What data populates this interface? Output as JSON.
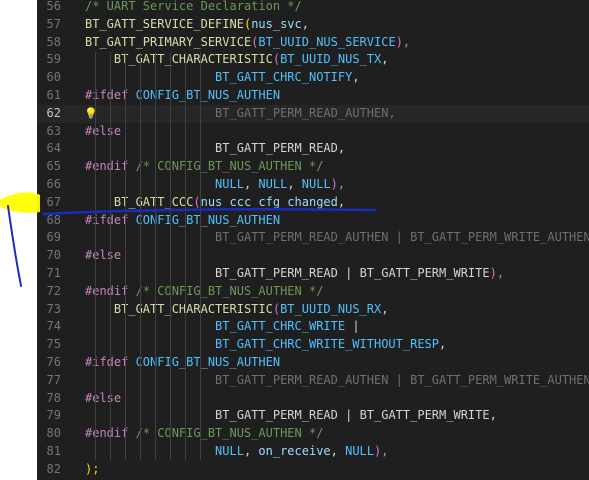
{
  "editor": {
    "current_line": 62,
    "lines": [
      {
        "num": "56",
        "tokens": [
          {
            "t": "/* UART Service Declaration */",
            "c": "t-comment"
          }
        ]
      },
      {
        "num": "57",
        "tokens": [
          {
            "t": "BT_GATT_SERVICE_DEFINE",
            "c": "t-macro"
          },
          {
            "t": "(",
            "c": "t-paren1"
          },
          {
            "t": "nus_svc",
            "c": "t-ident"
          },
          {
            "t": ",",
            "c": "t-plain"
          }
        ]
      },
      {
        "num": "58",
        "tokens": [
          {
            "t": "BT_GATT_PRIMARY_SERVICE",
            "c": "t-macro"
          },
          {
            "t": "(",
            "c": "t-paren2"
          },
          {
            "t": "BT_UUID_NUS_SERVICE",
            "c": "t-const"
          },
          {
            "t": "),",
            "c": "t-paren2"
          }
        ]
      },
      {
        "num": "59",
        "tokens": [
          {
            "t": "    BT_GATT_CHARACTERISTIC",
            "c": "t-macro"
          },
          {
            "t": "(",
            "c": "t-paren2"
          },
          {
            "t": "BT_UUID_NUS_TX",
            "c": "t-const"
          },
          {
            "t": ",",
            "c": "t-plain"
          }
        ]
      },
      {
        "num": "60",
        "tokens": [
          {
            "t": "                  BT_GATT_CHRC_NOTIFY",
            "c": "t-const"
          },
          {
            "t": ",",
            "c": "t-plain"
          }
        ]
      },
      {
        "num": "61",
        "tokens": [
          {
            "t": "#ifdef",
            "c": "t-pre"
          },
          {
            "t": " CONFIG_BT_NUS_AUTHEN",
            "c": "t-const"
          }
        ]
      },
      {
        "num": "62",
        "tokens": [
          {
            "t": "                  BT_GATT_PERM_READ_AUTHEN",
            "c": "t-dim"
          },
          {
            "t": ",",
            "c": "t-dim"
          }
        ]
      },
      {
        "num": "63",
        "tokens": [
          {
            "t": "#else",
            "c": "t-pre"
          }
        ]
      },
      {
        "num": "64",
        "tokens": [
          {
            "t": "                  BT_GATT_PERM_READ",
            "c": "t-plain"
          },
          {
            "t": ",",
            "c": "t-plain"
          }
        ]
      },
      {
        "num": "65",
        "tokens": [
          {
            "t": "#endif",
            "c": "t-pre"
          },
          {
            "t": " /* CONFIG_BT_NUS_AUTHEN */",
            "c": "t-comment"
          }
        ]
      },
      {
        "num": "66",
        "tokens": [
          {
            "t": "                  NULL",
            "c": "t-const"
          },
          {
            "t": ", ",
            "c": "t-plain"
          },
          {
            "t": "NULL",
            "c": "t-const"
          },
          {
            "t": ", ",
            "c": "t-plain"
          },
          {
            "t": "NULL",
            "c": "t-const"
          },
          {
            "t": "),",
            "c": "t-paren2"
          }
        ]
      },
      {
        "num": "67",
        "tokens": [
          {
            "t": "    BT_GATT_CCC",
            "c": "t-macro"
          },
          {
            "t": "(",
            "c": "t-paren2"
          },
          {
            "t": "nus_ccc_cfg_changed",
            "c": "t-ident"
          },
          {
            "t": ",",
            "c": "t-plain"
          }
        ]
      },
      {
        "num": "68",
        "tokens": [
          {
            "t": "#ifdef",
            "c": "t-pre"
          },
          {
            "t": " CONFIG_BT_NUS_AUTHEN",
            "c": "t-const"
          }
        ]
      },
      {
        "num": "69",
        "tokens": [
          {
            "t": "                  BT_GATT_PERM_READ_AUTHEN | BT_GATT_PERM_WRITE_AUTHEN",
            "c": "t-dim"
          }
        ]
      },
      {
        "num": "70",
        "tokens": [
          {
            "t": "#else",
            "c": "t-pre"
          }
        ]
      },
      {
        "num": "71",
        "tokens": [
          {
            "t": "                  BT_GATT_PERM_READ",
            "c": "t-plain"
          },
          {
            "t": " | ",
            "c": "t-plain"
          },
          {
            "t": "BT_GATT_PERM_WRITE",
            "c": "t-plain"
          },
          {
            "t": "),",
            "c": "t-paren2"
          }
        ]
      },
      {
        "num": "72",
        "tokens": [
          {
            "t": "#endif",
            "c": "t-pre"
          },
          {
            "t": " /* CONFIG_BT_NUS_AUTHEN */",
            "c": "t-comment"
          }
        ]
      },
      {
        "num": "73",
        "tokens": [
          {
            "t": "    BT_GATT_CHARACTERISTIC",
            "c": "t-macro"
          },
          {
            "t": "(",
            "c": "t-paren2"
          },
          {
            "t": "BT_UUID_NUS_RX",
            "c": "t-const"
          },
          {
            "t": ",",
            "c": "t-plain"
          }
        ]
      },
      {
        "num": "74",
        "tokens": [
          {
            "t": "                  BT_GATT_CHRC_WRITE",
            "c": "t-const"
          },
          {
            "t": " |",
            "c": "t-plain"
          }
        ]
      },
      {
        "num": "75",
        "tokens": [
          {
            "t": "                  BT_GATT_CHRC_WRITE_WITHOUT_RESP",
            "c": "t-const"
          },
          {
            "t": ",",
            "c": "t-plain"
          }
        ]
      },
      {
        "num": "76",
        "tokens": [
          {
            "t": "#ifdef",
            "c": "t-pre"
          },
          {
            "t": " CONFIG_BT_NUS_AUTHEN",
            "c": "t-const"
          }
        ]
      },
      {
        "num": "77",
        "tokens": [
          {
            "t": "                  BT_GATT_PERM_READ_AUTHEN | BT_GATT_PERM_WRITE_AUTHEN",
            "c": "t-dim"
          }
        ]
      },
      {
        "num": "78",
        "tokens": [
          {
            "t": "#else",
            "c": "t-pre"
          }
        ]
      },
      {
        "num": "79",
        "tokens": [
          {
            "t": "                  BT_GATT_PERM_READ",
            "c": "t-plain"
          },
          {
            "t": " | ",
            "c": "t-plain"
          },
          {
            "t": "BT_GATT_PERM_WRITE",
            "c": "t-plain"
          },
          {
            "t": ",",
            "c": "t-plain"
          }
        ]
      },
      {
        "num": "80",
        "tokens": [
          {
            "t": "#endif",
            "c": "t-pre"
          },
          {
            "t": " /* CONFIG_BT_NUS_AUTHEN */",
            "c": "t-comment"
          }
        ]
      },
      {
        "num": "81",
        "tokens": [
          {
            "t": "                  NULL",
            "c": "t-const"
          },
          {
            "t": ", ",
            "c": "t-plain"
          },
          {
            "t": "on_receive",
            "c": "t-ident"
          },
          {
            "t": ", ",
            "c": "t-plain"
          },
          {
            "t": "NULL",
            "c": "t-const"
          },
          {
            "t": "),",
            "c": "t-paren2"
          }
        ]
      },
      {
        "num": "82",
        "tokens": [
          {
            "t": ");",
            "c": "t-paren1"
          }
        ]
      }
    ]
  },
  "annotations": {
    "highlight_color": "#ffff00",
    "underline_color": "#1a2bbf",
    "ink_color": "#1a2bbf"
  },
  "icons": {
    "lightbulb": "lightbulb-icon"
  }
}
